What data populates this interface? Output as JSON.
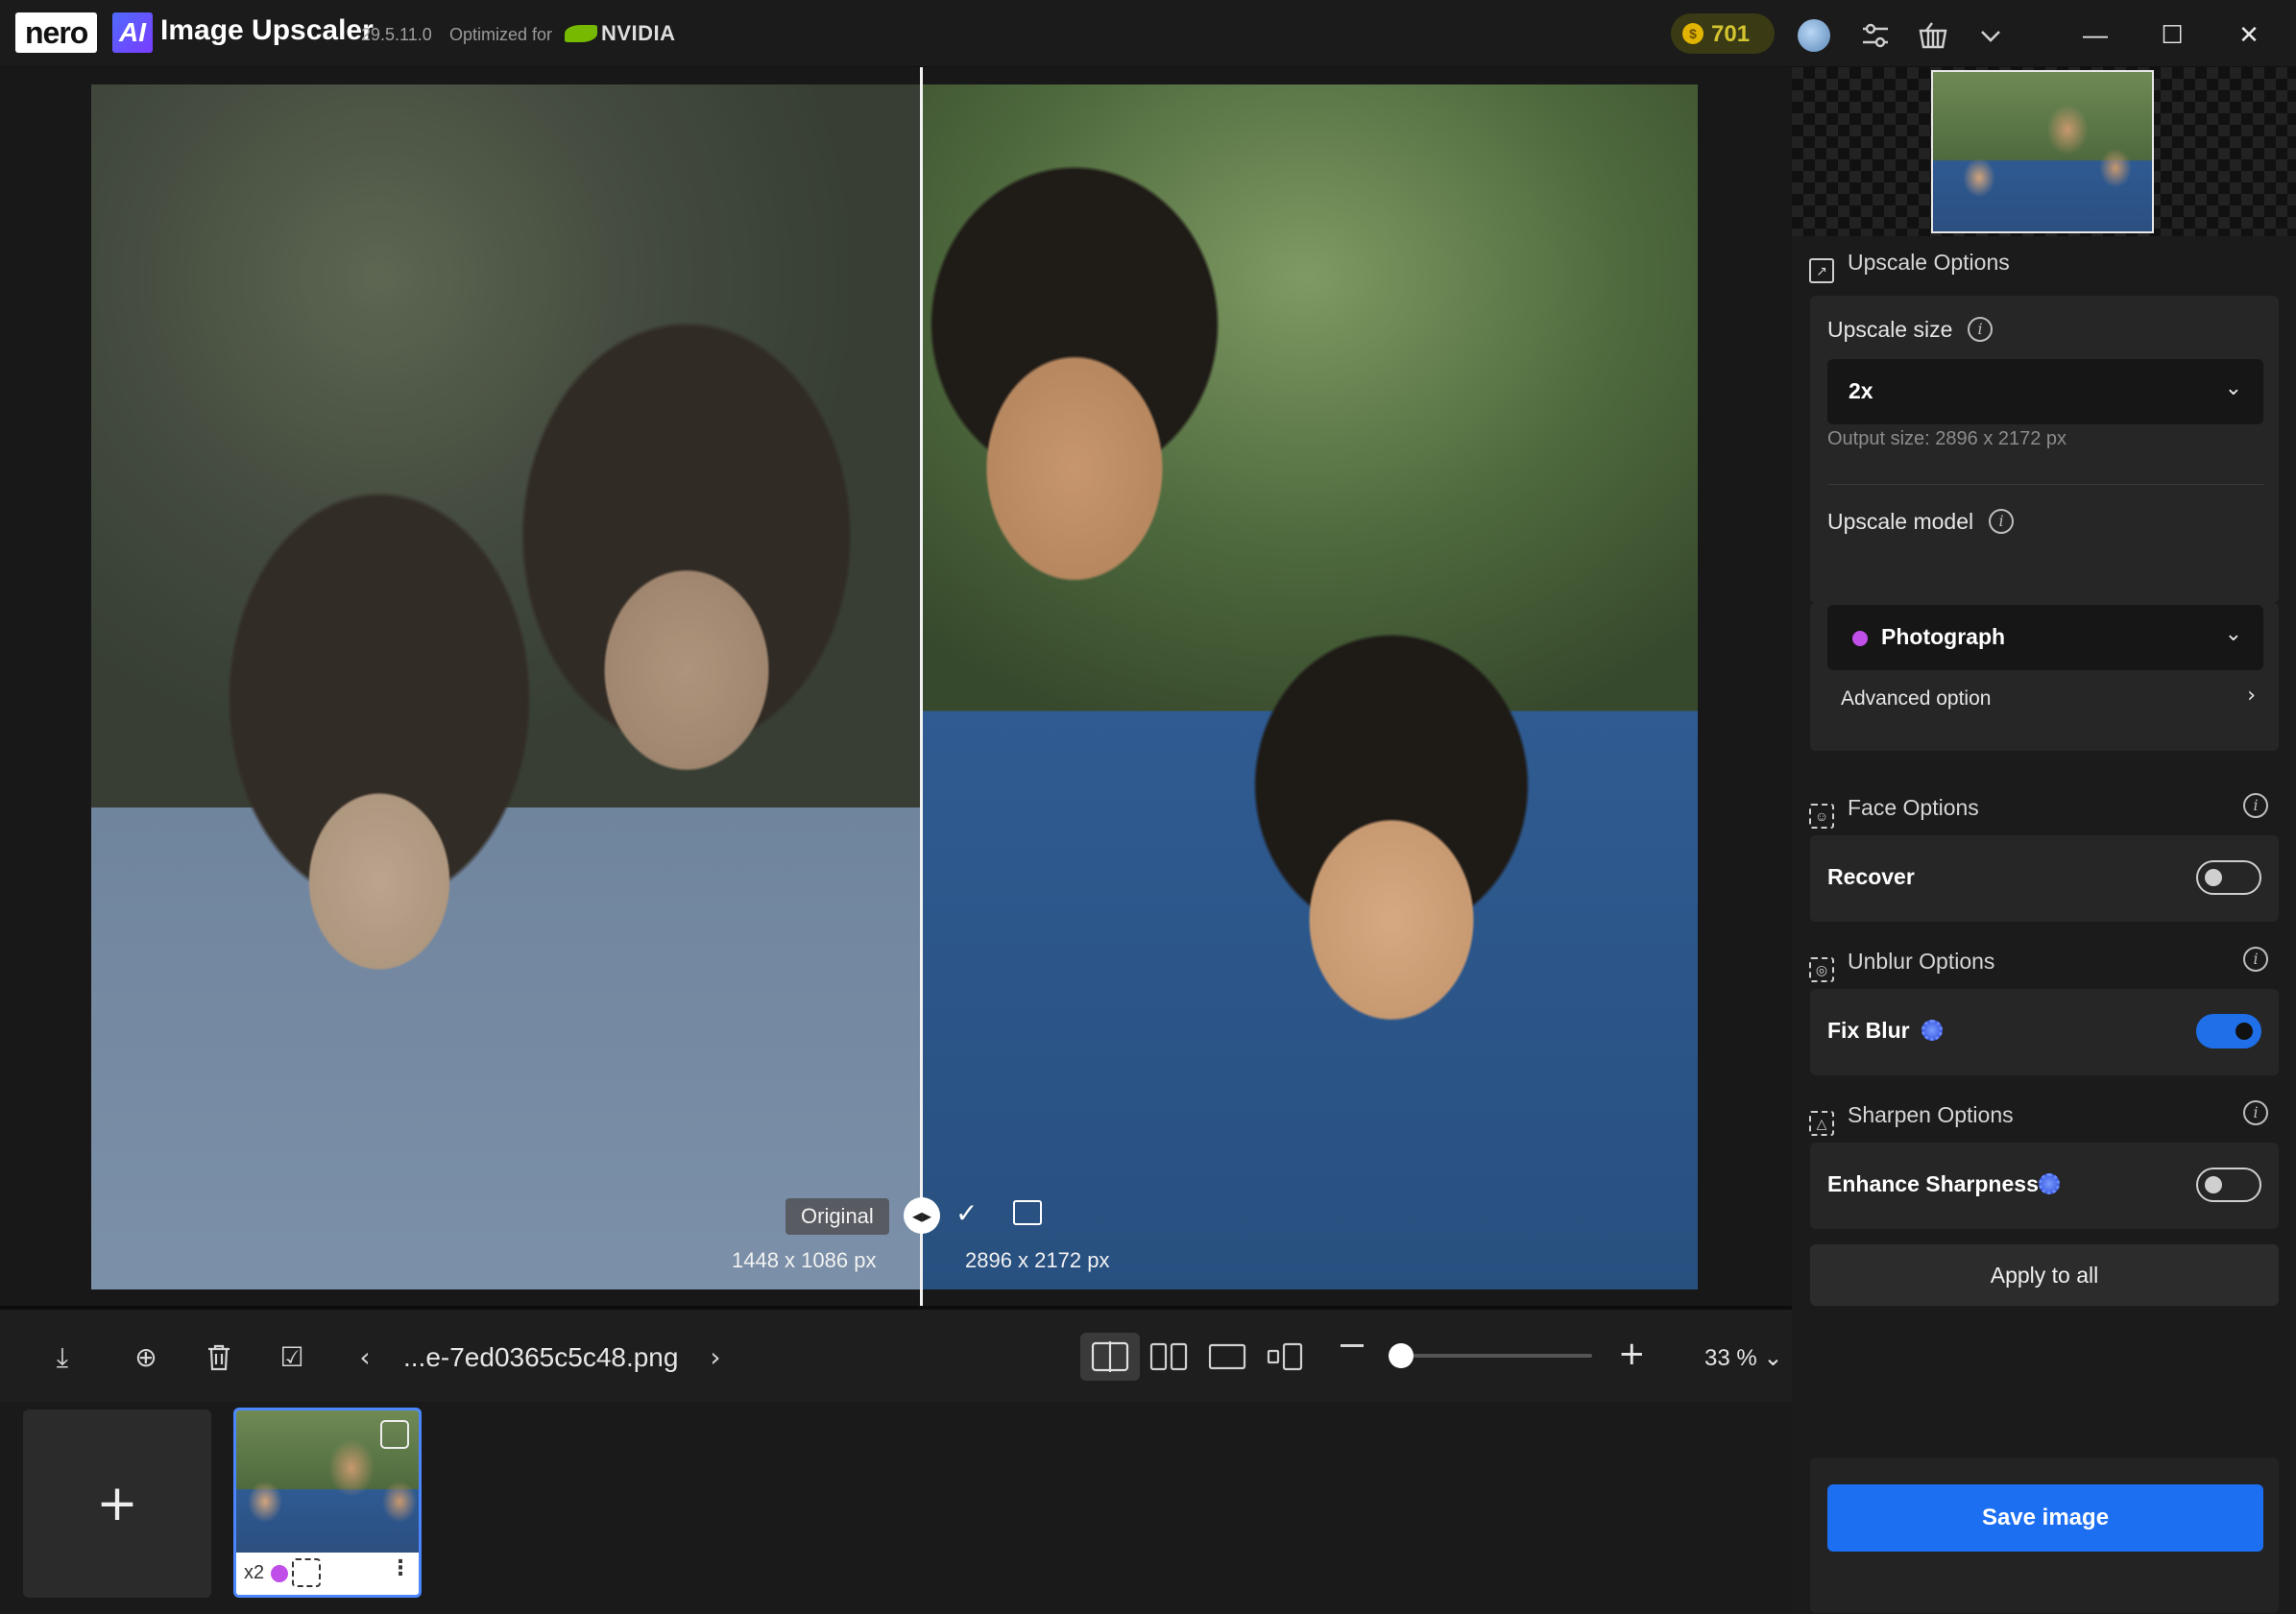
{
  "app": {
    "brand": "nero",
    "ai_badge": "AI",
    "title": "Image Upscaler",
    "version": "29.5.11.0",
    "optimized_for": "Optimized for",
    "partner": "NVIDIA",
    "credits": "701",
    "coin_symbol": "$"
  },
  "window_controls": {
    "minimize": "—",
    "maximize": "☐",
    "close": "✕"
  },
  "title_icons": [
    "avatar",
    "sliders-icon",
    "basket-icon",
    "chevron-down-icon"
  ],
  "canvas": {
    "original_label": "Original",
    "original_size": "1448 x 1086 px",
    "upscaled_size": "2896 x 2172 px",
    "split_handle": "◂▸",
    "check": "✓"
  },
  "toolbar": {
    "filename": "...e-7ed0365c5c48.png",
    "prev": "‹",
    "next": "›",
    "zoom": "33 %",
    "zoom_chevron": "⌄",
    "zoom_fraction": 0.05,
    "icons": {
      "download": "⤓",
      "add": "⊕",
      "delete": "🗑",
      "select": "☑",
      "plus": "+"
    },
    "view_modes": [
      "split-view",
      "side-by-side",
      "single-view",
      "compare-small"
    ]
  },
  "strip": {
    "add_label": "+",
    "thumb": {
      "scale": "x2",
      "more": "⋮"
    }
  },
  "panel": {
    "upscale_options": "Upscale Options",
    "upscale_size_label": "Upscale size",
    "upscale_size_value": "2x",
    "output_size": "Output size: 2896 x 2172 px",
    "upscale_model_label": "Upscale model",
    "upscale_model_value": "Photograph",
    "advanced_option": "Advanced option",
    "face_options": "Face Options",
    "recover": "Recover",
    "recover_on": false,
    "unblur_options": "Unblur Options",
    "fix_blur": "Fix Blur",
    "fix_blur_on": true,
    "sharpen_options": "Sharpen Options",
    "enhance_sharpness": "Enhance Sharpness",
    "enhance_sharpness_on": false,
    "apply_to_all": "Apply to all",
    "save_image": "Save image",
    "info": "i",
    "chevron_down": "⌄",
    "chevron_right": "›"
  },
  "colors": {
    "accent": "#1d6ff2",
    "model_dot": "#c04ee8",
    "credits": "#d4c430",
    "nvidia": "#76b900"
  }
}
